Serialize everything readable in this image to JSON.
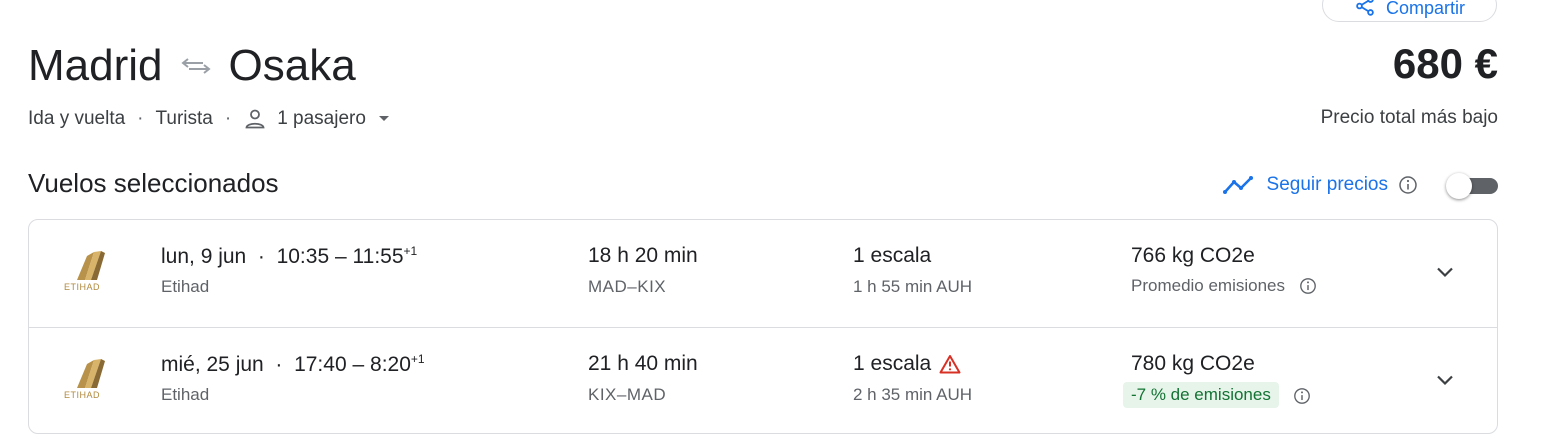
{
  "share": {
    "label": "Compartir"
  },
  "header": {
    "origin": "Madrid",
    "destination": "Osaka",
    "price": "680 €",
    "price_note": "Precio total más bajo"
  },
  "trip": {
    "type": "Ida y vuelta",
    "separator": "·",
    "cabin": "Turista",
    "passengers": "1 pasajero"
  },
  "section": {
    "title": "Vuelos seleccionados",
    "track_label": "Seguir precios",
    "track_enabled": false
  },
  "flights": [
    {
      "logo_text": "ETIHAD",
      "date": "lun, 9 jun",
      "dot": "·",
      "dep": "10:35",
      "dash": "–",
      "arr": "11:55",
      "plus_days": "+1",
      "airline": "Etihad",
      "duration": "18 h 20 min",
      "route": "MAD–KIX",
      "stops": "1 escala",
      "stop_warning": false,
      "layover": "1 h 55 min AUH",
      "co2": "766 kg CO2e",
      "emissions_note": "Promedio emisiones"
    },
    {
      "logo_text": "ETIHAD",
      "date": "mié, 25 jun",
      "dot": "·",
      "dep": "17:40",
      "dash": "–",
      "arr": "8:20",
      "plus_days": "+1",
      "airline": "Etihad",
      "duration": "21 h 40 min",
      "route": "KIX–MAD",
      "stops": "1 escala",
      "stop_warning": true,
      "layover": "2 h 35 min AUH",
      "co2": "780 kg CO2e",
      "emissions_note": "-7 % de emisiones"
    }
  ],
  "colors": {
    "accent": "#1a73e8",
    "warning": "#d93025",
    "badge_bg": "#e6f4ea",
    "badge_text": "#137333",
    "logo_gold": "#b08a3e"
  },
  "icons": {
    "share": "share-icon",
    "swap": "swap-arrows-icon",
    "person": "person-icon",
    "caret": "caret-down-icon",
    "trend": "trending-line-icon",
    "info": "info-icon",
    "warning": "warning-triangle-icon",
    "expand": "chevron-down-icon"
  }
}
